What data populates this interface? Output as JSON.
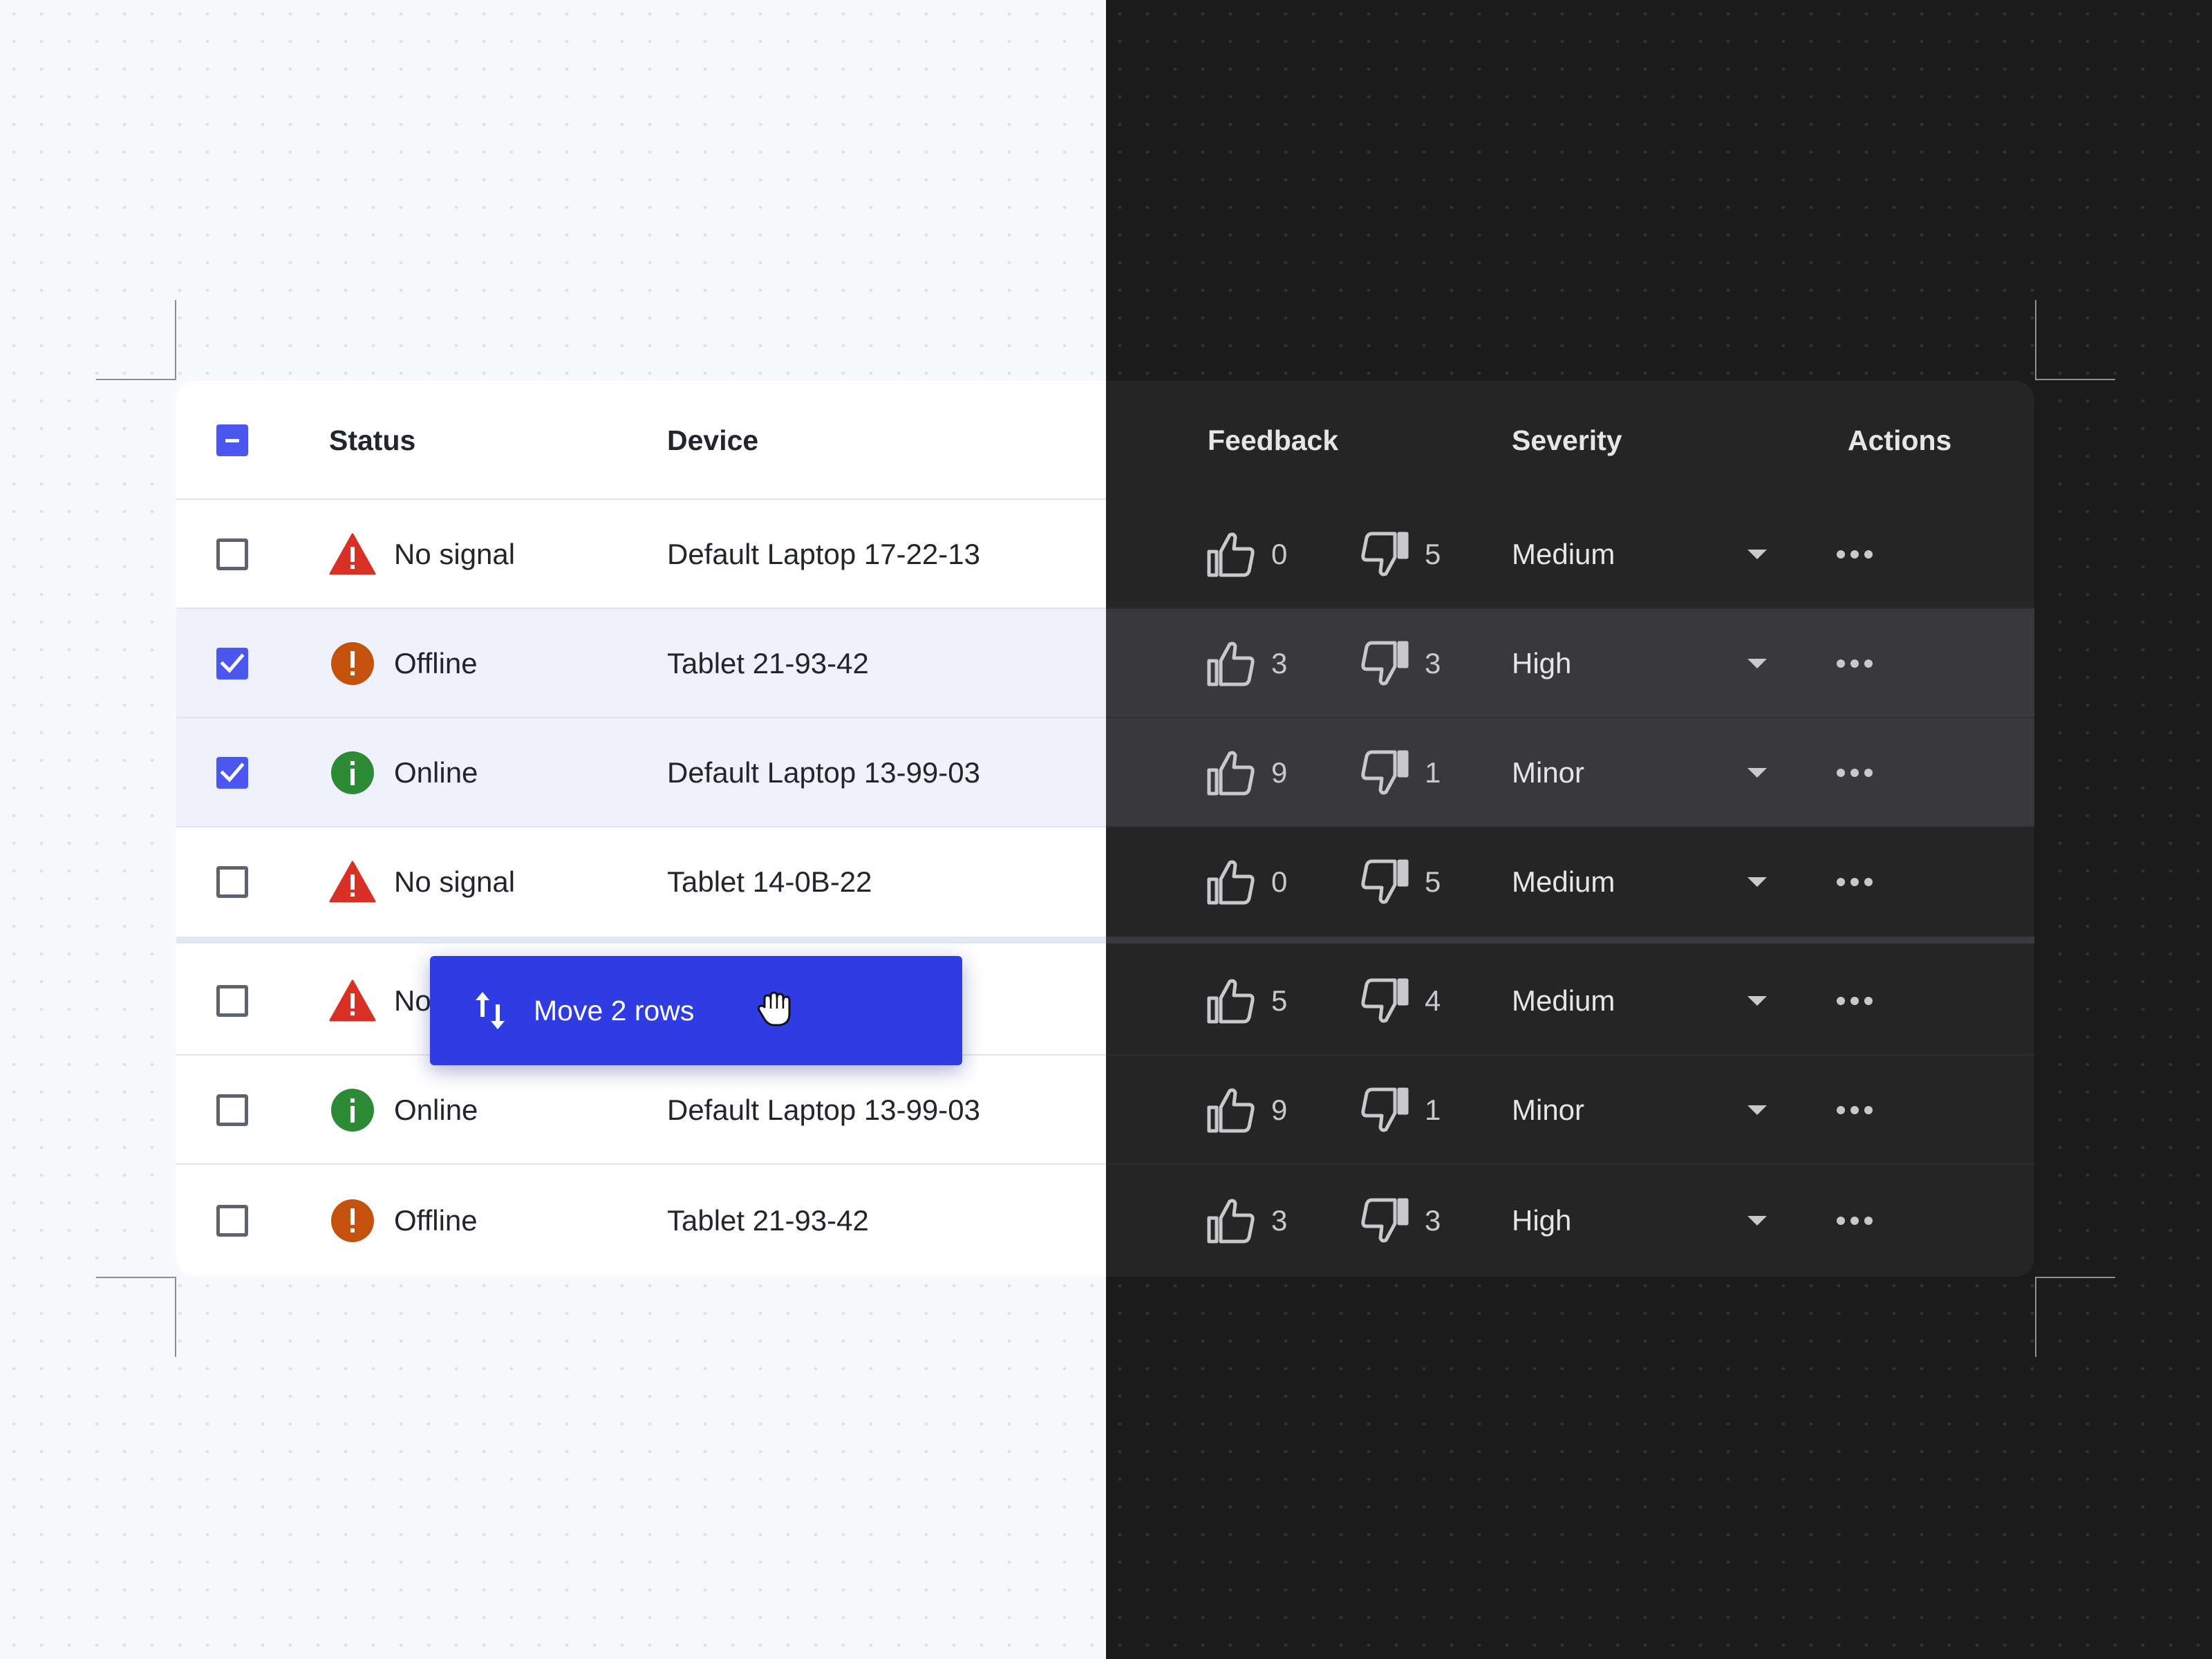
{
  "columns": {
    "status": "Status",
    "device": "Device",
    "feedback": "Feedback",
    "severity": "Severity",
    "actions": "Actions"
  },
  "rows": [
    {
      "checked": false,
      "status": "No signal",
      "status_icon": "warning-triangle-icon",
      "device": "Default Laptop 17-22-13",
      "likes": "0",
      "dislikes": "5",
      "severity": "Medium"
    },
    {
      "checked": true,
      "status": "Offline",
      "status_icon": "error-circle-icon",
      "device": "Tablet 21-93-42",
      "likes": "3",
      "dislikes": "3",
      "severity": "High"
    },
    {
      "checked": true,
      "status": "Online",
      "status_icon": "info-circle-icon",
      "device": "Default Laptop 13-99-03",
      "likes": "9",
      "dislikes": "1",
      "severity": "Minor"
    },
    {
      "checked": false,
      "status": "No signal",
      "status_icon": "warning-triangle-icon",
      "device": "Tablet 14-0B-22",
      "likes": "0",
      "dislikes": "5",
      "severity": "Medium"
    },
    {
      "checked": false,
      "status": "No signal",
      "status_icon": "warning-triangle-icon",
      "device": "",
      "likes": "5",
      "dislikes": "4",
      "severity": "Medium"
    },
    {
      "checked": false,
      "status": "Online",
      "status_icon": "info-circle-icon",
      "device": "Default Laptop 13-99-03",
      "likes": "9",
      "dislikes": "1",
      "severity": "Minor"
    },
    {
      "checked": false,
      "status": "Offline",
      "status_icon": "error-circle-icon",
      "device": "Tablet 21-93-42",
      "likes": "3",
      "dislikes": "3",
      "severity": "High"
    }
  ],
  "drag_chip": {
    "label": "Move 2 rows",
    "icon": "swap-vertical-icon",
    "cursor": "grab-hand-cursor-icon"
  },
  "colors": {
    "accent": "#2f3be3",
    "checkbox": "#4c57ef",
    "warning": "#d93025",
    "error": "#c4510c",
    "success": "#2e8b35",
    "light_surface": "#ffffff",
    "dark_surface": "#252526"
  }
}
